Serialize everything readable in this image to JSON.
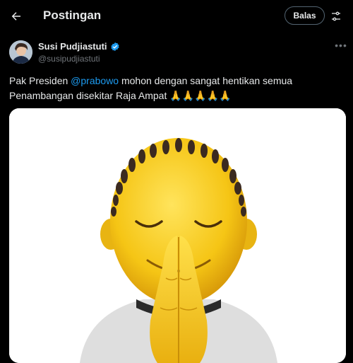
{
  "header": {
    "title": "Postingan",
    "reply_label": "Balas",
    "back_icon": "arrow-left-icon",
    "filter_icon": "sliders-icon"
  },
  "post": {
    "author_name": "Susi Pudjiastuti",
    "author_handle": "@susipudjiastuti",
    "verified": true,
    "text_before": "Pak Presiden ",
    "mention": "@prabowo",
    "text_after": " mohon dengan sangat hentikan semua Penambangan disekitar Raja Ampat ",
    "emoji": "🙏🙏🙏🙏🙏",
    "more_icon": "more-icon"
  },
  "colors": {
    "background": "#000000",
    "text": "#e7e9ea",
    "muted": "#71767b",
    "link": "#1d9bf0",
    "verified_badge": "#1d9bf0"
  }
}
